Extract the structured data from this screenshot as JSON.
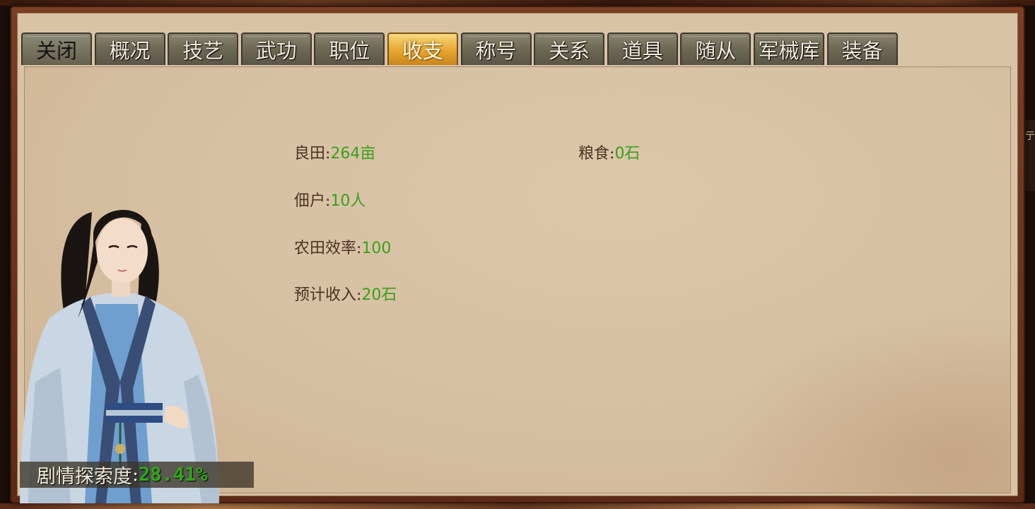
{
  "tabs": [
    {
      "label": "关闭",
      "name": "tab-close"
    },
    {
      "label": "概况",
      "name": "tab-overview"
    },
    {
      "label": "技艺",
      "name": "tab-skills"
    },
    {
      "label": "武功",
      "name": "tab-martial-arts"
    },
    {
      "label": "职位",
      "name": "tab-position"
    },
    {
      "label": "收支",
      "name": "tab-income"
    },
    {
      "label": "称号",
      "name": "tab-titles"
    },
    {
      "label": "关系",
      "name": "tab-relations"
    },
    {
      "label": "道具",
      "name": "tab-items"
    },
    {
      "label": "随从",
      "name": "tab-followers"
    },
    {
      "label": "军械库",
      "name": "tab-armory"
    },
    {
      "label": "装备",
      "name": "tab-equipment"
    }
  ],
  "active_tab": "收支",
  "separator": ":",
  "stats": {
    "farmland": {
      "label": "良田",
      "value": "264亩"
    },
    "grain": {
      "label": "粮食",
      "value": "0石"
    },
    "tenants": {
      "label": "佃户",
      "value": "10人"
    },
    "efficiency": {
      "label": "农田效率",
      "value": "100"
    },
    "expected_income": {
      "label": "预计收入",
      "value": "20石"
    }
  },
  "exploration": {
    "label": "剧情探索度",
    "value": "28.41%"
  },
  "side_glyph": "亍",
  "colors": {
    "value_green": "#3aa01a",
    "label_brown": "#4a3322",
    "active_tab_gold": "#e6a52e",
    "tab_gray": "#6e6a56",
    "panel_bg": "#d6bfa2",
    "frame_brown": "#6a3320"
  }
}
